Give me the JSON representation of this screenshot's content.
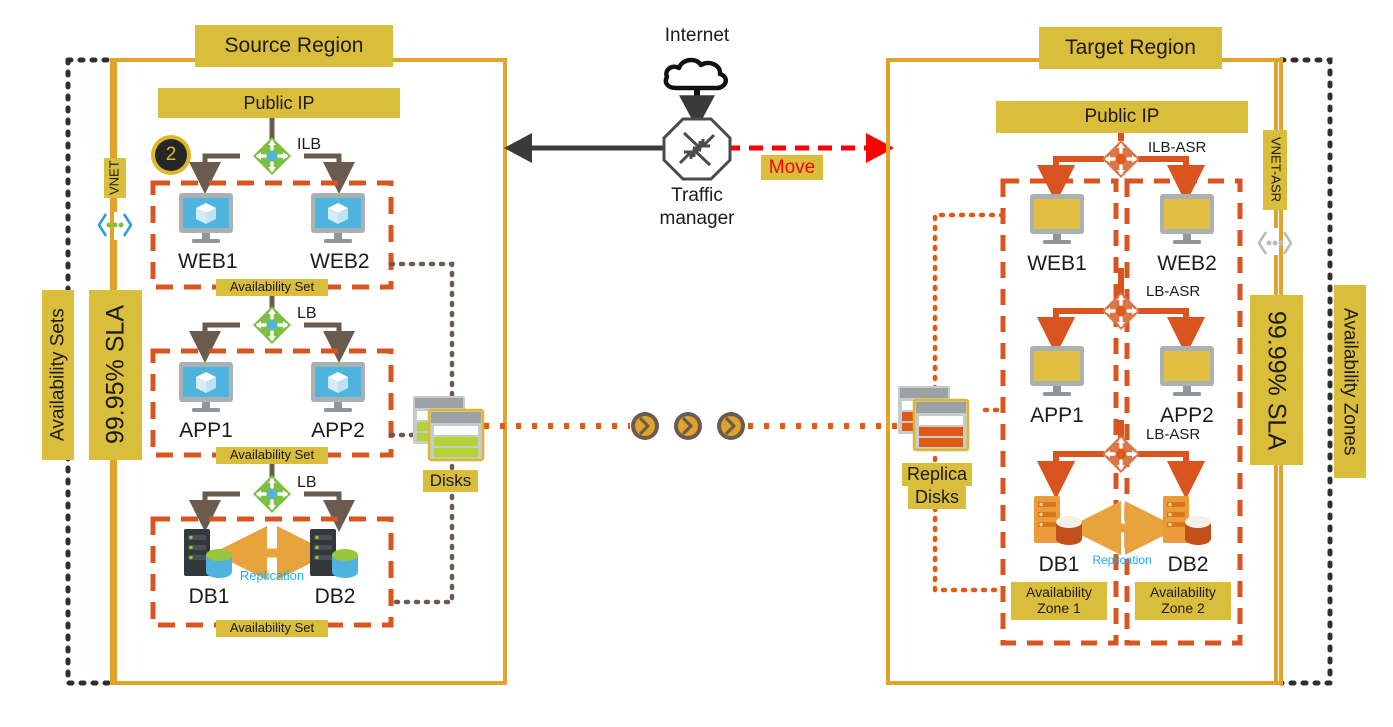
{
  "diagram": {
    "title": "Azure Site Recovery region move: Availability Sets to Availability Zones",
    "colors": {
      "gold": "#d9bd3b",
      "region_border": "#e0a42b",
      "orange_dash": "#d9541e",
      "brown": "#6b5a4e",
      "blue_vm": "#4fb3e0",
      "green_lb": "#7cc043",
      "red_move": "#ff0000",
      "dark_badge": "#262626",
      "cyan_text": "#18b0ee",
      "amber_arrow": "#e8a33d"
    }
  },
  "center": {
    "internet_label": "Internet",
    "traffic_manager_label_line1": "Traffic",
    "traffic_manager_label_line2": "manager",
    "move_label": "Move",
    "internet_icon": "cloud-icon",
    "traffic_manager_icon": "traffic-manager-octagon-icon",
    "left_arrow_icon": "arrow-left-icon",
    "move_arrow_icon": "arrow-right-dashed-icon"
  },
  "source": {
    "region_title": "Source Region",
    "public_ip": "Public IP",
    "step_badge": "2",
    "vnet_label": "VNET",
    "sla_label": "99.95% SLA",
    "outer_label": "Availability Sets",
    "vnet_icon": "vnet-chevron-icon",
    "disks": {
      "label": "Disks",
      "icon": "disks-stack-icon"
    },
    "tiers": [
      {
        "lb_label": "ILB",
        "lb_icon": "load-balancer-icon",
        "group_label": "Availability Set",
        "nodes": [
          {
            "name": "WEB1",
            "icon": "virtual-machine-icon"
          },
          {
            "name": "WEB2",
            "icon": "virtual-machine-icon"
          }
        ]
      },
      {
        "lb_label": "LB",
        "lb_icon": "load-balancer-icon",
        "group_label": "Availability Set",
        "nodes": [
          {
            "name": "APP1",
            "icon": "virtual-machine-icon"
          },
          {
            "name": "APP2",
            "icon": "virtual-machine-icon"
          }
        ]
      },
      {
        "lb_label": "LB",
        "lb_icon": "load-balancer-icon",
        "group_label": "Availability Set",
        "replication_label": "Replication",
        "replication_icon": "bidirectional-arrow-icon",
        "nodes": [
          {
            "name": "DB1",
            "icon": "database-server-icon"
          },
          {
            "name": "DB2",
            "icon": "database-server-icon"
          }
        ]
      }
    ]
  },
  "target": {
    "region_title": "Target Region",
    "public_ip": "Public IP",
    "vnet_label": "VNET-ASR",
    "sla_label": "99.99% SLA",
    "outer_label": "Availability Zones",
    "vnet_icon": "vnet-chevron-icon",
    "replica_disks": {
      "label_line1": "Replica",
      "label_line2": "Disks",
      "icon": "replica-disks-stack-icon"
    },
    "tiers": [
      {
        "lb_label": "ILB-ASR",
        "lb_icon": "load-balancer-asr-icon",
        "nodes": [
          {
            "name": "WEB1",
            "icon": "virtual-machine-icon"
          },
          {
            "name": "WEB2",
            "icon": "virtual-machine-icon"
          }
        ]
      },
      {
        "lb_label": "LB-ASR",
        "lb_icon": "load-balancer-asr-icon",
        "nodes": [
          {
            "name": "APP1",
            "icon": "virtual-machine-icon"
          },
          {
            "name": "APP2",
            "icon": "virtual-machine-icon"
          }
        ]
      },
      {
        "lb_label": "LB-ASR",
        "lb_icon": "load-balancer-asr-icon",
        "replication_label": "Replication",
        "replication_icon": "bidirectional-arrow-icon",
        "nodes": [
          {
            "name": "DB1",
            "icon": "database-server-icon"
          },
          {
            "name": "DB2",
            "icon": "database-server-icon"
          }
        ]
      }
    ],
    "zones": [
      {
        "label_line1": "Availability",
        "label_line2": "Zone 1"
      },
      {
        "label_line1": "Availability",
        "label_line2": "Zone 2"
      }
    ]
  },
  "replication_path": {
    "chevron_icon": "chevron-circle-icon",
    "chevron_count": 3
  }
}
